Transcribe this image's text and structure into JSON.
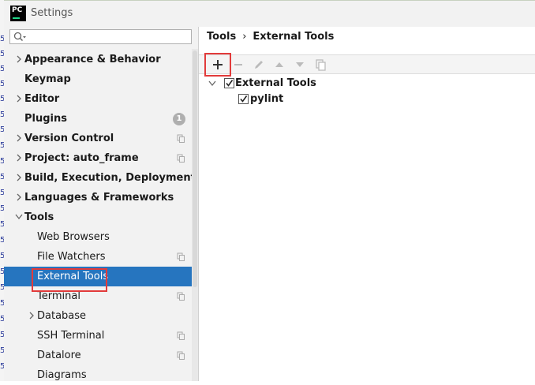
{
  "window": {
    "title": "Settings",
    "logo_text": "PC"
  },
  "search": {
    "placeholder": ""
  },
  "sidebar": {
    "items": [
      {
        "label": "Appearance & Behavior",
        "bold": true,
        "chevron": "right",
        "indent": 0
      },
      {
        "label": "Keymap",
        "bold": true,
        "chevron": "none",
        "indent": 0
      },
      {
        "label": "Editor",
        "bold": true,
        "chevron": "right",
        "indent": 0
      },
      {
        "label": "Plugins",
        "bold": true,
        "chevron": "none",
        "indent": 0,
        "badge": "1"
      },
      {
        "label": "Version Control",
        "bold": true,
        "chevron": "right",
        "indent": 0,
        "copy_icon": true
      },
      {
        "label": "Project: auto_frame",
        "bold": true,
        "chevron": "right",
        "indent": 0,
        "copy_icon": true
      },
      {
        "label": "Build, Execution, Deployment",
        "bold": true,
        "chevron": "right",
        "indent": 0
      },
      {
        "label": "Languages & Frameworks",
        "bold": true,
        "chevron": "right",
        "indent": 0
      },
      {
        "label": "Tools",
        "bold": true,
        "chevron": "down",
        "indent": 0
      },
      {
        "label": "Web Browsers",
        "bold": false,
        "chevron": "none",
        "indent": 1
      },
      {
        "label": "File Watchers",
        "bold": false,
        "chevron": "none",
        "indent": 1,
        "copy_icon": true
      },
      {
        "label": "External Tools",
        "bold": false,
        "chevron": "none",
        "indent": 1,
        "selected": true
      },
      {
        "label": "Terminal",
        "bold": false,
        "chevron": "none",
        "indent": 1,
        "copy_icon": true
      },
      {
        "label": "Database",
        "bold": false,
        "chevron": "right",
        "indent": 1
      },
      {
        "label": "SSH Terminal",
        "bold": false,
        "chevron": "none",
        "indent": 1,
        "copy_icon": true
      },
      {
        "label": "Datalore",
        "bold": false,
        "chevron": "none",
        "indent": 1,
        "copy_icon": true
      },
      {
        "label": "Diagrams",
        "bold": false,
        "chevron": "none",
        "indent": 1
      }
    ]
  },
  "breadcrumb": {
    "parent": "Tools",
    "separator": "›",
    "current": "External Tools"
  },
  "toolbar": {
    "buttons": [
      {
        "name": "add-button",
        "icon": "plus-icon",
        "enabled": true
      },
      {
        "name": "remove-button",
        "icon": "minus-icon",
        "enabled": false
      },
      {
        "name": "edit-button",
        "icon": "pencil-icon",
        "enabled": false
      },
      {
        "name": "move-up-button",
        "icon": "arrow-up-icon",
        "enabled": false
      },
      {
        "name": "move-down-button",
        "icon": "arrow-down-icon",
        "enabled": false
      },
      {
        "name": "copy-button",
        "icon": "copy-icon",
        "enabled": false
      }
    ]
  },
  "tools_tree": {
    "group": {
      "label": "External Tools",
      "checked": true,
      "expanded": true
    },
    "children": [
      {
        "label": "pylint",
        "checked": true
      }
    ]
  },
  "colors": {
    "selection": "#2675bf",
    "highlight": "#e23b3b",
    "panel_bg": "#f2f2f2"
  }
}
